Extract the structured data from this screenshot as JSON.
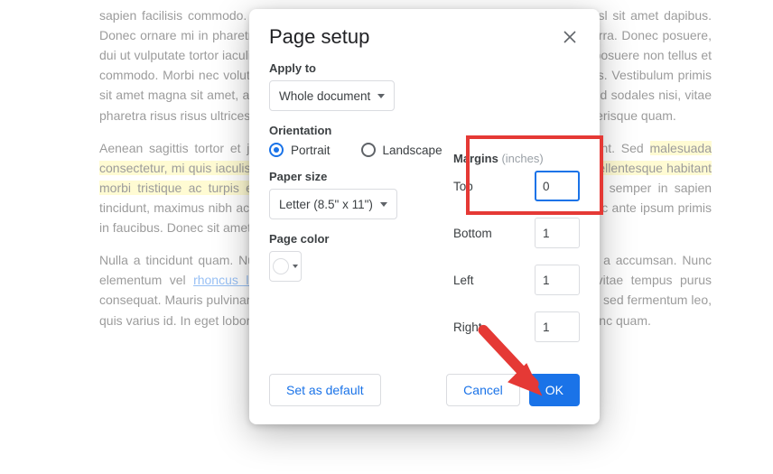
{
  "doc": {
    "p1": "sapien facilisis commodo. Nullam vitae elit. Curabitur aliquam eu. Etiam elementum nisl sit amet dapibus. Donec ornare mi in pharetra, eget tincidunt porta risus ullamcorper. Duis consequat viverra. Donec posuere, dui ut vulputate tortor iaculis eros. Fusce a arcu efficitur. Nullam gravida arcu lacus, nec posuere non tellus et commodo. Morbi nec volutpat augue. Sed egestas magna, a egestas nulla enim a lectus. Vestibulum primis sit amet magna sit amet, aliquet tincidunt eu in ante. ",
    "p1b": " mauris volutpat. Duis sed sodales nisi, vitae pharetra risus risus ultrices neque. Objective mattis enim quis, ullamcorper ex. Nunc scelerisque quam.",
    "p2a": "Aenean sagittis tortor et justo bibendum porttitor. Etiam tristique tellus facilisis tincidunt. Sed ",
    "p2b": ". Phasellus dolor eget velit posuere feugiat. Integer semper in sapien tincidunt, maximus nibh ac, gravida diam. Morbi faucibus interdum et malesuada fames ac ante ipsum primis in faucibus. Donec sit amet sed ante rutrum, vel hendrerit erat.",
    "p3a": "Nulla a tincidunt quam. Nullam lacinia arcu eu ultrices hendrerit. Ut tortor leo, suscipit a accumsan. Nunc elementum vel ",
    "p3b": ". Suspendisse et justo faucibus, pharetra metus, vitae tempus purus consequat. Mauris pulvinar nulla porta sed lacinia. In auctor vel magna et convallis. Morbi sed fermentum leo, quis varius id. In eget lobortis nisi. Morbi bibendum, quam ultricies tempor. Integer non nunc quam.",
    "hl_vest": "Vestibulum",
    "hl_1": "malesuada consectetur, mi quis iaculis maximus, mauris pharetra bibendum. Mauris tincidunt erat. Pellentesque habitant morbi tristique ac turpis egestas",
    "link_1": "rhoncus lobortis"
  },
  "dialog": {
    "title": "Page setup",
    "apply_to_lbl": "Apply to",
    "apply_to_value": "Whole document",
    "orientation_lbl": "Orientation",
    "radio_portrait": "Portrait",
    "radio_landscape": "Landscape",
    "paper_size_lbl": "Paper size",
    "paper_size_value": "Letter (8.5\" x 11\")",
    "page_color_lbl": "Page color",
    "margins_lbl": "Margins",
    "margins_unit": "(inches)",
    "margin_top_lbl": "Top",
    "margin_top_val": "0",
    "margin_bottom_lbl": "Bottom",
    "margin_bottom_val": "1",
    "margin_left_lbl": "Left",
    "margin_left_val": "1",
    "margin_right_lbl": "Right",
    "margin_right_val": "1",
    "btn_default": "Set as default",
    "btn_cancel": "Cancel",
    "btn_ok": "OK"
  }
}
